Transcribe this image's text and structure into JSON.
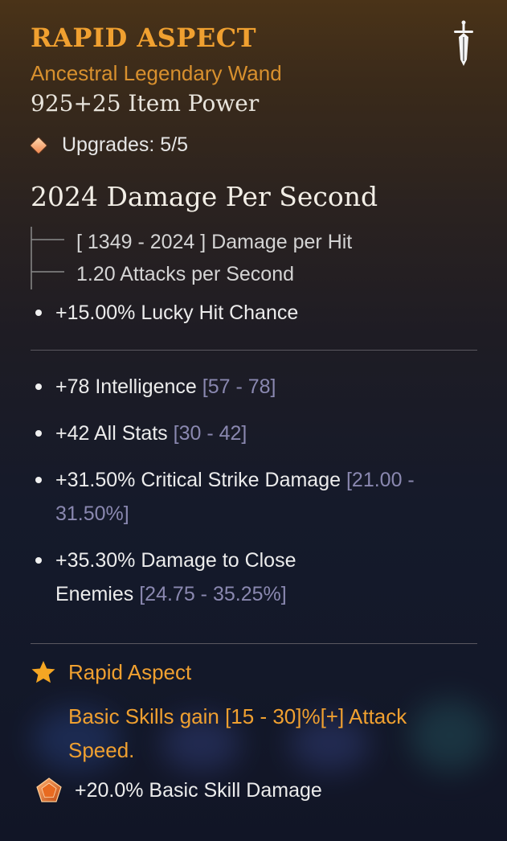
{
  "header": {
    "title": "RAPID ASPECT",
    "subtitle": "Ancestral Legendary Wand",
    "item_power": "925+25 Item Power",
    "weapon_icon": "dagger-icon"
  },
  "upgrades": {
    "label": "Upgrades: 5/5"
  },
  "damage": {
    "dps": "2024 Damage Per Second",
    "per_hit": "[ 1349 - 2024 ] Damage per Hit",
    "attacks": "1.20 Attacks per Second"
  },
  "implicit": [
    {
      "text": "+15.00% Lucky Hit Chance",
      "range": ""
    }
  ],
  "affixes": [
    {
      "text": "+78 Intelligence ",
      "range": "[57 - 78]"
    },
    {
      "text": "+42 All Stats ",
      "range": "[30 - 42]"
    },
    {
      "text": "+31.50% Critical Strike Damage ",
      "range": "[21.00 - 31.50%]"
    },
    {
      "text": "+35.30% Damage to Close Enemies ",
      "range": "[24.75 - 35.25%]"
    }
  ],
  "aspect": {
    "icon": "star-icon",
    "name": "Rapid Aspect",
    "description": "Basic Skills gain [15 - 30]%[+] Attack Speed."
  },
  "gem": {
    "icon": "pentagon-gem-icon",
    "text": "+20.0% Basic Skill Damage"
  },
  "colors": {
    "legendary": "#f0a030",
    "range": "#8a88b0",
    "text": "#e6e6e6"
  }
}
